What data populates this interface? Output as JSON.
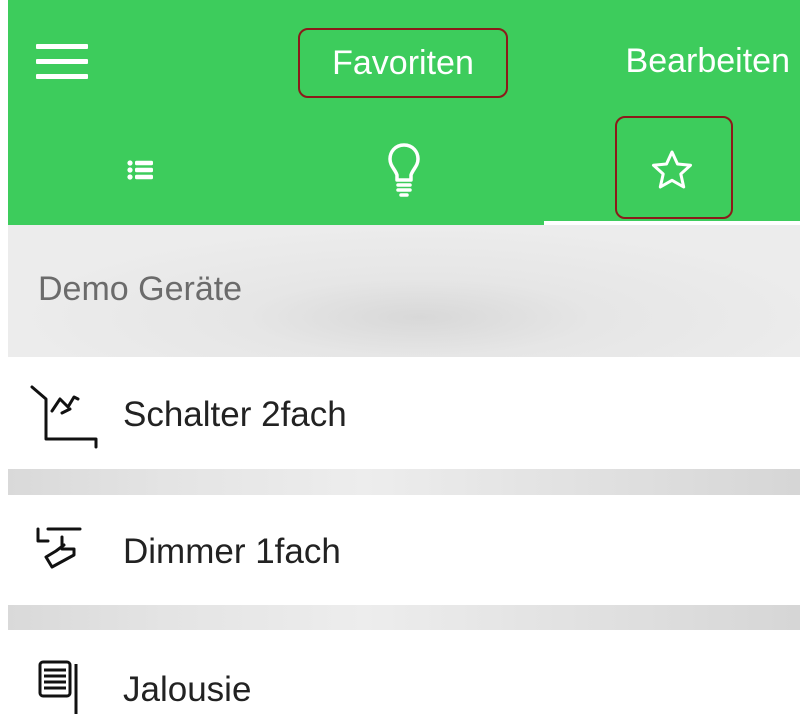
{
  "header": {
    "title": "Favoriten",
    "edit_label": "Bearbeiten",
    "menu_icon": "hamburger-menu-icon",
    "accent_color": "#3dcc5c",
    "highlight_color": "#8c1a1a"
  },
  "tabs": [
    {
      "name": "list",
      "icon": "list-icon",
      "selected": false
    },
    {
      "name": "lights",
      "icon": "lightbulb-icon",
      "selected": false
    },
    {
      "name": "favorites",
      "icon": "star-icon",
      "selected": true
    }
  ],
  "section": {
    "title": "Demo Geräte"
  },
  "devices": [
    {
      "label": "Schalter 2fach",
      "icon": "switch-icon"
    },
    {
      "label": "Dimmer 1fach",
      "icon": "dimmer-icon"
    },
    {
      "label": "Jalousie",
      "icon": "blind-icon"
    }
  ]
}
